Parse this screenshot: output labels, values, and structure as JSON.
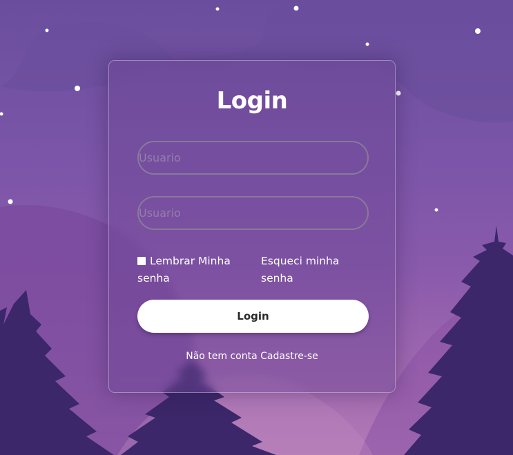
{
  "login_card": {
    "title": "Login",
    "username_placeholder": "Usuario",
    "username_value": "",
    "password_placeholder": "Usuario",
    "password_value": "",
    "remember_label": "Lembrar Minha senha",
    "remember_checked": false,
    "forgot_label": "Esqueci minha senha",
    "submit_label": "Login",
    "signup_prompt": "Não tem conta",
    "signup_link": "Cadastre-se"
  },
  "colors": {
    "background_top": "#6a4e9d",
    "background_bottom": "#b27ab6",
    "tree_color": "#3a2668",
    "card_border": "rgba(255,255,255,0.35)",
    "button_bg": "#ffffff",
    "text": "#ffffff"
  },
  "icons": {
    "checkbox": "checkbox-icon",
    "stars": "star-icon",
    "trees": "pine-tree-icon"
  }
}
